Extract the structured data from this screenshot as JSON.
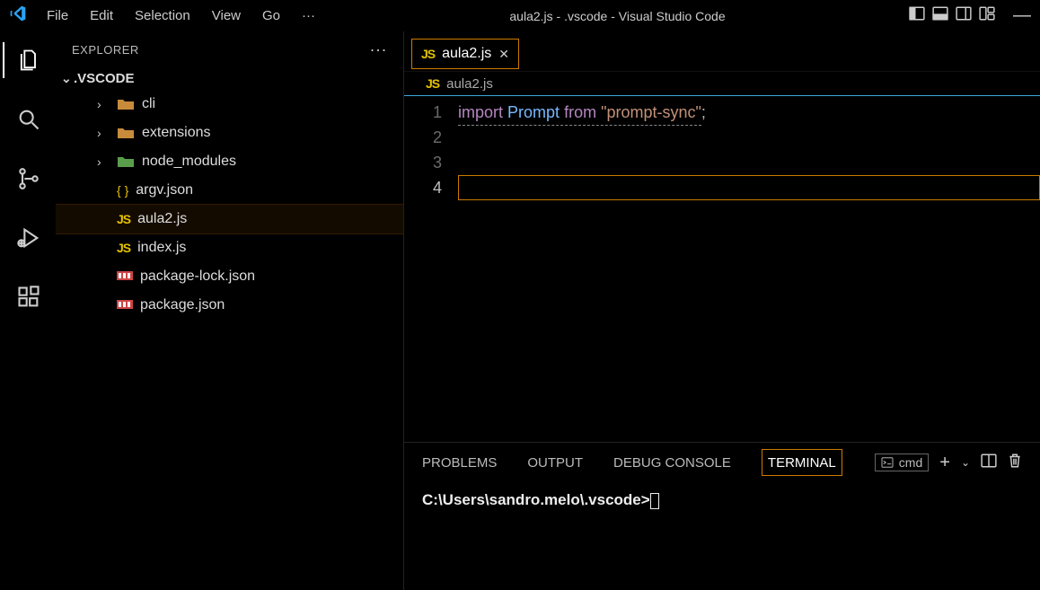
{
  "title": "aula2.js - .vscode - Visual Studio Code",
  "menu": [
    "File",
    "Edit",
    "Selection",
    "View",
    "Go"
  ],
  "sidebar": {
    "title": "EXPLORER",
    "root": ".VSCODE",
    "items": [
      {
        "name": "cli",
        "type": "folder",
        "chev": true
      },
      {
        "name": "extensions",
        "type": "folder",
        "chev": true
      },
      {
        "name": "node_modules",
        "type": "folder-green",
        "chev": true
      },
      {
        "name": "argv.json",
        "type": "json",
        "chev": false
      },
      {
        "name": "aula2.js",
        "type": "js",
        "chev": false,
        "active": true
      },
      {
        "name": "index.js",
        "type": "js",
        "chev": false
      },
      {
        "name": "package-lock.json",
        "type": "pkg",
        "chev": false
      },
      {
        "name": "package.json",
        "type": "pkg",
        "chev": false
      }
    ]
  },
  "tab": {
    "label": "aula2.js"
  },
  "breadcrumb": {
    "label": "aula2.js"
  },
  "code": {
    "lines": [
      "1",
      "2",
      "3",
      "4"
    ],
    "currentLine": 4,
    "tokens": {
      "import": "import",
      "var": "Prompt",
      "from": "from",
      "str": "\"prompt-sync\"",
      "semi": ";"
    }
  },
  "panel": {
    "tabs": [
      "PROBLEMS",
      "OUTPUT",
      "DEBUG CONSOLE",
      "TERMINAL"
    ],
    "activeTab": "TERMINAL",
    "shell": "cmd",
    "prompt": "C:\\Users\\sandro.melo\\.vscode>"
  }
}
